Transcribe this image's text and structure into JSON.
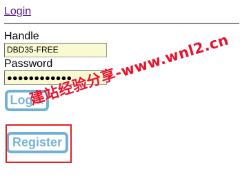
{
  "header": {
    "login_link": "Login"
  },
  "form": {
    "handle_label": "Handle",
    "handle_value": "DBD35-FREE",
    "password_label": "Password",
    "password_value": "●●●●●●●●●●●●"
  },
  "buttons": {
    "login_label": "Login",
    "register_label": "Register"
  },
  "overlay": {
    "watermark_text": "建站经验分享-www.wnl2.cn",
    "watermark_color": "#e8132b",
    "highlight_color": "#e02020"
  },
  "colors": {
    "button_border": "#6fb1d9",
    "button_text": "#78b4d8",
    "input_background": "#fafad2",
    "link": "#551a8b"
  }
}
